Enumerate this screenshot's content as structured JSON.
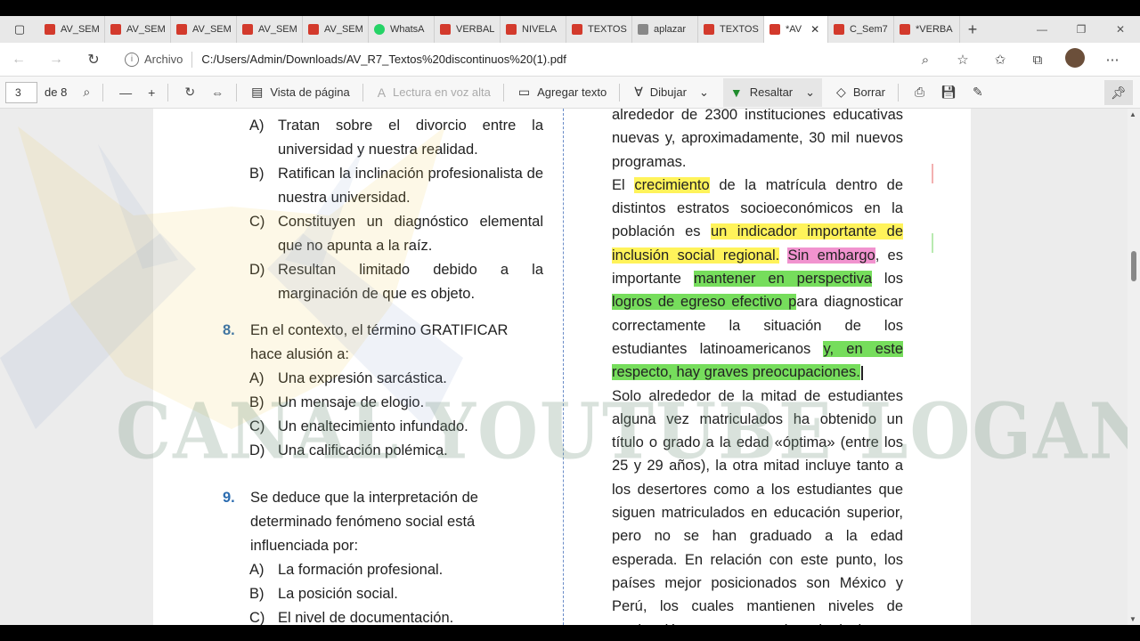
{
  "tabs": [
    {
      "label": "AV_SEM",
      "type": "pdf"
    },
    {
      "label": "AV_SEM",
      "type": "pdf"
    },
    {
      "label": "AV_SEM",
      "type": "pdf"
    },
    {
      "label": "AV_SEM",
      "type": "pdf"
    },
    {
      "label": "AV_SEM",
      "type": "pdf"
    },
    {
      "label": "WhatsA",
      "type": "wa"
    },
    {
      "label": "VERBAL",
      "type": "pdf"
    },
    {
      "label": "NIVELA",
      "type": "pdf"
    },
    {
      "label": "TEXTOS",
      "type": "pdf"
    },
    {
      "label": "aplazar",
      "type": "yh"
    },
    {
      "label": "TEXTOS",
      "type": "pdf"
    },
    {
      "label": "*AV",
      "type": "pdf",
      "active": true
    },
    {
      "label": "C_Sem7",
      "type": "pdf"
    },
    {
      "label": "*VERBA",
      "type": "pdf"
    }
  ],
  "address": {
    "label": "Archivo",
    "url": "C:/Users/Admin/Downloads/AV_R7_Textos%20discontinuos%20(1).pdf"
  },
  "pdf_toolbar": {
    "page_current": "3",
    "page_total": "de 8",
    "page_view": "Vista de página",
    "read_aloud": "Lectura en voz alta",
    "add_text": "Agregar texto",
    "draw": "Dibujar",
    "highlight": "Resaltar",
    "erase": "Borrar"
  },
  "left_column": {
    "q7_options": [
      {
        "key": "A)",
        "text": "Tratan sobre el divorcio entre la universidad y nuestra realidad."
      },
      {
        "key": "B)",
        "text": "Ratifican la inclinación profesionalista de nuestra universidad."
      },
      {
        "key": "C)",
        "text": "Constituyen un diagnóstico elemental que no apunta a la raíz."
      },
      {
        "key": "D)",
        "text": "Resultan limitado debido a la marginación de que es objeto."
      }
    ],
    "q8": {
      "number": "8.",
      "text": "En el contexto, el término GRATIFICAR hace alusión a:",
      "options": [
        {
          "key": "A)",
          "text": "Una expresión sarcástica."
        },
        {
          "key": "B)",
          "text": "Un mensaje de elogio."
        },
        {
          "key": "C)",
          "text": "Un enaltecimiento infundado."
        },
        {
          "key": "D)",
          "text": "Una calificación polémica."
        }
      ]
    },
    "q9": {
      "number": "9.",
      "text": "Se deduce que la interpretación de determinado fenómeno social está influenciada por:",
      "options": [
        {
          "key": "A)",
          "text": "La formación profesional."
        },
        {
          "key": "B)",
          "text": "La posición social."
        },
        {
          "key": "C)",
          "text": "El nivel de documentación."
        }
      ]
    }
  },
  "right_column": {
    "p1": "alrededor de 2300 instituciones educativas nuevas y, aproximadamente, 30 mil nuevos programas.",
    "p2": {
      "s1": "El ",
      "h1": "crecimiento",
      "s2": " de la matrícula dentro de distintos estratos socioeconómicos en la población es ",
      "h2": "un indicador importante de inclusión social regional.",
      "s3": " ",
      "h3": "Sin embargo",
      "s4": ", es importante ",
      "h4": "mantener en perspectiva",
      "s5": " los ",
      "h5": "logros de egreso efectivo p",
      "s6": "ara diagnosticar correctamente la situación de los estudiantes latinoamericanos ",
      "h6": "y, en este respecto, hay graves preocupaciones."
    },
    "p3": "Solo alrededor de la mitad de estudiantes alguna vez matriculados ha obtenido un título o grado a la edad «óptima» (entre los 25 y 29 años), la otra mitad incluye tanto a los desertores como a los estudiantes que siguen matriculados en educación superior, pero no se han graduado a la edad esperada. En relación con este punto, los países mejor posicionados son México y Perú, los cuales mantienen niveles de graduación cercanos a la mitad de sus estudiantes."
  },
  "watermark": "CANAL YOUTUBE LOGAN MATHS",
  "colors": {
    "highlight_yellow": "#fff35a",
    "highlight_pink": "#f193cf",
    "highlight_green": "#76dd5c",
    "question_number": "#2b6cb0"
  }
}
